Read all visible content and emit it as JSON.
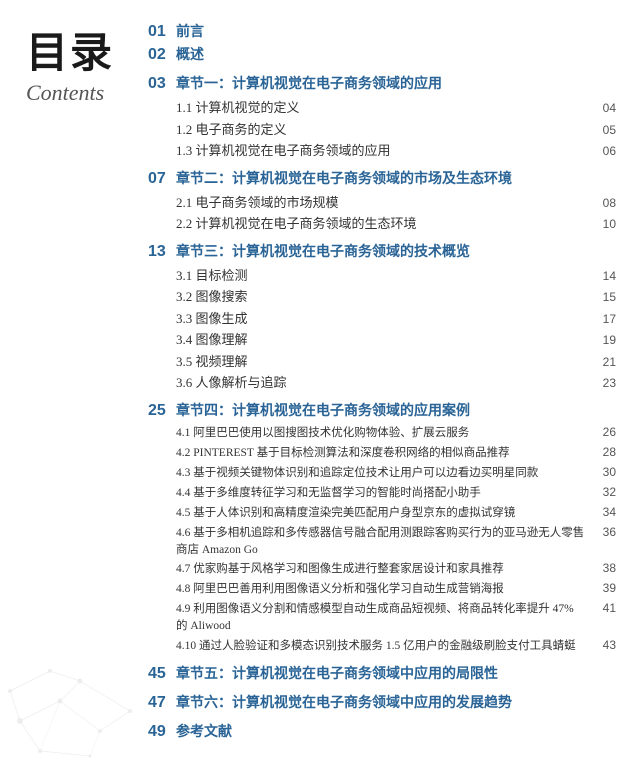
{
  "sidebar": {
    "title_cn": "目录",
    "title_en": "Contents"
  },
  "toc": {
    "sections": [
      {
        "type": "chapter-simple",
        "number": "01",
        "text": "前言",
        "page": ""
      },
      {
        "type": "chapter-simple",
        "number": "02",
        "text": "概述",
        "page": ""
      },
      {
        "type": "chapter",
        "number": "03",
        "text": "章节一：计算机视觉在电子商务领域的应用",
        "page": "",
        "subsections": [
          {
            "number": "1.1",
            "text": "计算机视觉的定义",
            "page": "04"
          },
          {
            "number": "1.2",
            "text": "电子商务的定义",
            "page": "05"
          },
          {
            "number": "1.3",
            "text": "计算机视觉在电子商务领域的应用",
            "page": "06"
          }
        ]
      },
      {
        "type": "chapter",
        "number": "07",
        "text": "章节二：计算机视觉在电子商务领域的市场及生态环境",
        "page": "",
        "subsections": [
          {
            "number": "2.1",
            "text": "电子商务领域的市场规模",
            "page": "08"
          },
          {
            "number": "2.2",
            "text": "计算机视觉在电子商务领域的生态环境",
            "page": "10"
          }
        ]
      },
      {
        "type": "chapter",
        "number": "13",
        "text": "章节三：计算机视觉在电子商务领域的技术概览",
        "page": "",
        "subsections": [
          {
            "number": "3.1",
            "text": "目标检测",
            "page": "14"
          },
          {
            "number": "3.2",
            "text": "图像搜索",
            "page": "15"
          },
          {
            "number": "3.3",
            "text": "图像生成",
            "page": "17"
          },
          {
            "number": "3.4",
            "text": "图像理解",
            "page": "19"
          },
          {
            "number": "3.5",
            "text": "视频理解",
            "page": "21"
          },
          {
            "number": "3.6",
            "text": "人像解析与追踪",
            "page": "23"
          }
        ]
      },
      {
        "type": "chapter",
        "number": "25",
        "text": "章节四：计算机视觉在电子商务领域的应用案例",
        "page": "",
        "subsections": [
          {
            "number": "4.1",
            "text": "阿里巴巴使用以图搜图技术优化购物体验、扩展云服务",
            "page": "26"
          },
          {
            "number": "4.2",
            "text": "PINTEREST 基于目标检测算法和深度卷积网络的相似商品推荐",
            "page": "28"
          },
          {
            "number": "4.3",
            "text": "基于视频关键物体识别和追踪定位技术让用户可以边看边买明星同款",
            "page": "30"
          },
          {
            "number": "4.4",
            "text": "基于多维度转征学习和无监督学习的智能时尚搭配小助手",
            "page": "32"
          },
          {
            "number": "4.5",
            "text": "基于人体识别和高精度渲染完美匹配用户身型京东的虚拟试穿镜",
            "page": "34"
          },
          {
            "number": "4.6",
            "text": "基于多相机追踪和多传感器信号融合配用测跟踪客购买行为的亚马逊无人零售商店 Amazon Go",
            "page": "36"
          },
          {
            "number": "4.7",
            "text": "优家购基于风格学习和图像生成进行整套家居设计和家具推荐",
            "page": "38"
          },
          {
            "number": "4.8",
            "text": "阿里巴巴善用利用图像语义分析和强化学习自动生成营销海报",
            "page": "39"
          },
          {
            "number": "4.9",
            "text": "利用图像语义分割和情感模型自动生成商品短视频、将商品转化率提升 47% 的 Aliwood",
            "page": "41"
          },
          {
            "number": "4.10",
            "text": "通过人脸验证和多模态识别技术服务 1.5 亿用户的金融级刷脸支付工具蜻蜓",
            "page": "43"
          }
        ]
      },
      {
        "type": "chapter-simple",
        "number": "45",
        "text": "章节五：计算机视觉在电子商务领域中应用的局限性",
        "page": ""
      },
      {
        "type": "chapter-simple",
        "number": "47",
        "text": "章节六：计算机视觉在电子商务领域中应用的发展趋势",
        "page": ""
      },
      {
        "type": "chapter-simple",
        "number": "49",
        "text": "参考文献",
        "page": ""
      }
    ]
  }
}
